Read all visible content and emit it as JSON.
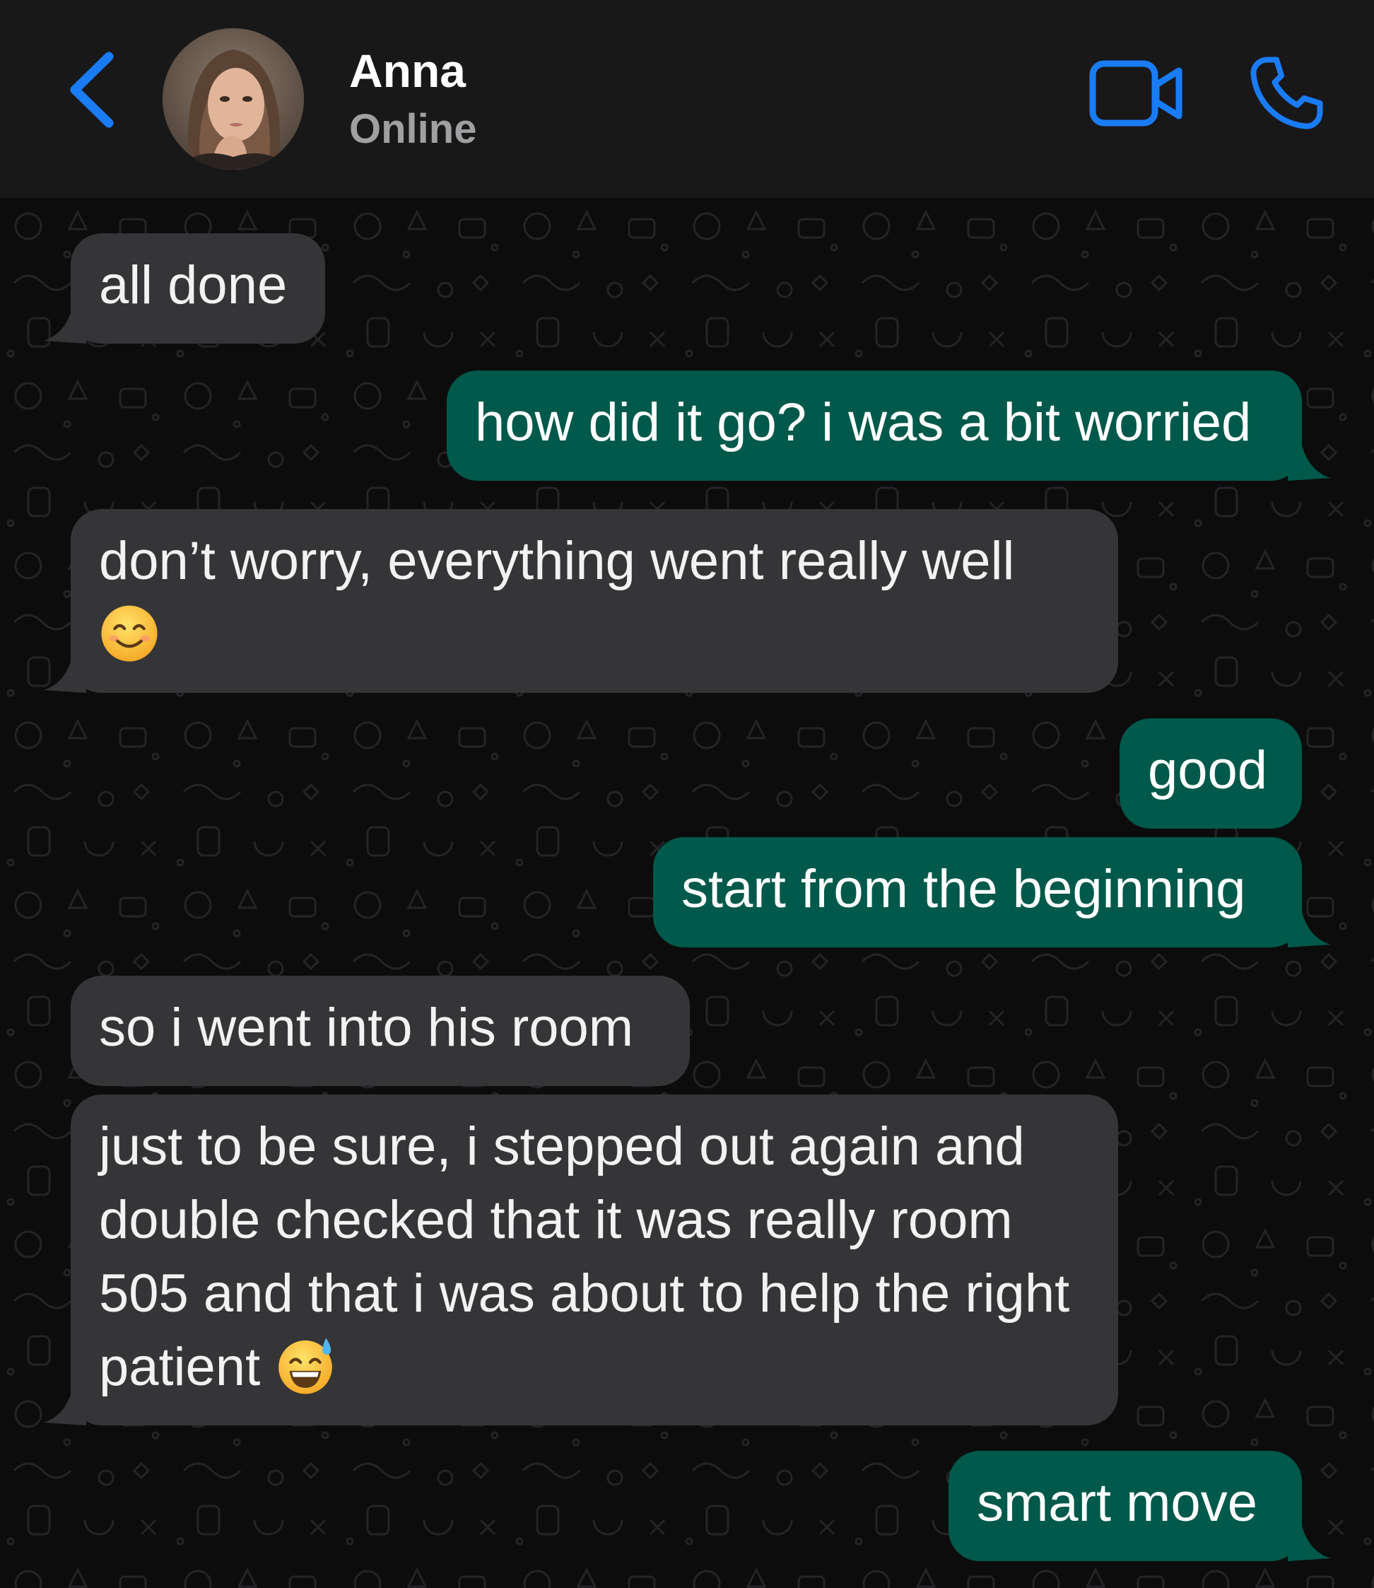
{
  "header": {
    "contact_name": "Anna",
    "contact_status": "Online",
    "accent_color": "#1a7cf5",
    "icons": {
      "back": "chevron-left-icon",
      "video": "video-camera-icon",
      "call": "phone-icon"
    }
  },
  "theme": {
    "incoming_bubble": "#353537",
    "outgoing_bubble": "#00594a",
    "chat_background": "#0c0c0d"
  },
  "messages": [
    {
      "direction": "in",
      "text": "all done",
      "emoji": ""
    },
    {
      "direction": "out",
      "text": "how did it go? i was a bit worried",
      "emoji": ""
    },
    {
      "direction": "in",
      "text": "don’t worry, everything went really well",
      "emoji": "smiling-face-with-smiling-eyes"
    },
    {
      "direction": "out",
      "text": "good",
      "emoji": ""
    },
    {
      "direction": "out",
      "text": "start from the beginning",
      "emoji": ""
    },
    {
      "direction": "in",
      "text": "so i went into his room",
      "emoji": ""
    },
    {
      "direction": "in",
      "text": "just to be sure, i stepped out again and double checked that it was really room 505 and that i was about to help the right patient",
      "emoji": "grinning-face-with-sweat"
    },
    {
      "direction": "out",
      "text": "smart move",
      "emoji": ""
    }
  ]
}
